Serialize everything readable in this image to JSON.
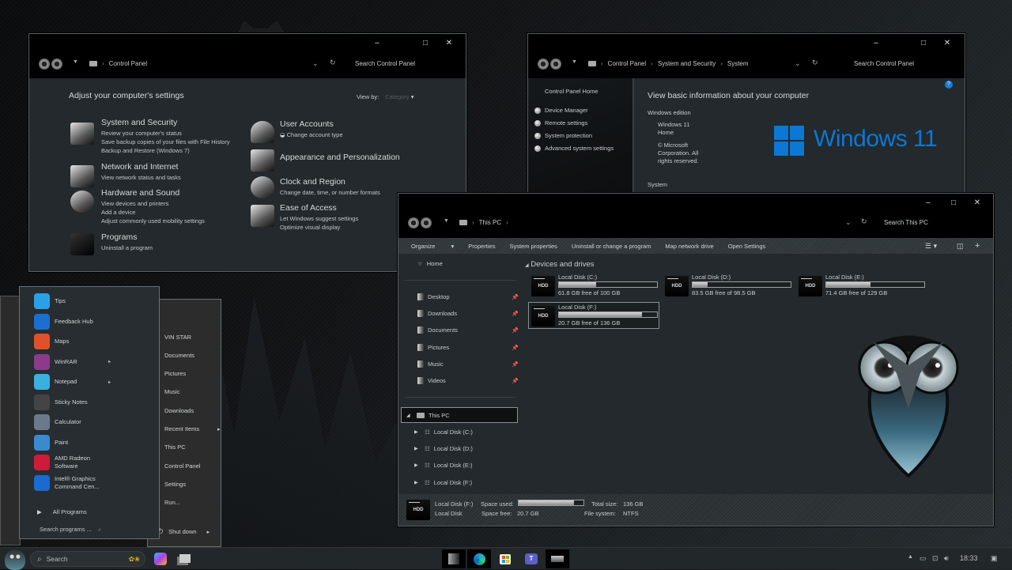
{
  "control_panel": {
    "breadcrumb": [
      "Control Panel"
    ],
    "search_placeholder": "Search Control Panel",
    "heading": "Adjust your computer's settings",
    "view_by_label": "View by:",
    "view_by_value": "Category",
    "categories": [
      {
        "title": "System and Security",
        "links": [
          "Review your computer's status",
          "Save backup copies of your files with File History",
          "Backup and Restore (Windows 7)"
        ]
      },
      {
        "title": "Network and Internet",
        "links": [
          "View network status and tasks"
        ]
      },
      {
        "title": "Hardware and Sound",
        "links": [
          "View devices and printers",
          "Add a device",
          "Adjust commonly used mobility settings"
        ]
      },
      {
        "title": "Programs",
        "links": [
          "Uninstall a program"
        ]
      },
      {
        "title": "User Accounts",
        "links": [
          "Change account type"
        ]
      },
      {
        "title": "Appearance and Personalization",
        "links": []
      },
      {
        "title": "Clock and Region",
        "links": [
          "Change date, time, or number formats"
        ]
      },
      {
        "title": "Ease of Access",
        "links": [
          "Let Windows suggest settings",
          "Optimize visual display"
        ]
      }
    ]
  },
  "system_window": {
    "breadcrumb": [
      "Control Panel",
      "System and Security",
      "System"
    ],
    "search_placeholder": "Search Control Panel",
    "sidebar_home": "Control Panel Home",
    "sidebar_links": [
      "Device Manager",
      "Remote settings",
      "System protection",
      "Advanced system settings"
    ],
    "heading": "View basic information about your computer",
    "edition_label": "Windows edition",
    "edition_name": "Windows 11 Home",
    "copyright": "© Microsoft Corporation. All rights reserved.",
    "logo_text": "Windows 11",
    "system_label": "System",
    "accent": "#0a78d4"
  },
  "explorer": {
    "breadcrumb": [
      "This PC"
    ],
    "search_placeholder": "Search This PC",
    "commands": [
      "Organize",
      "Properties",
      "System properties",
      "Uninstall or change a program",
      "Map network drive",
      "Open Settings"
    ],
    "nav_home": "Home",
    "quick_access": [
      "Desktop",
      "Downloads",
      "Documents",
      "Pictures",
      "Music",
      "Videos"
    ],
    "tree_root": "This PC",
    "tree_children": [
      "Local Disk (C:)",
      "Local Disk (D:)",
      "Local Disk (E:)",
      "Local Disk (F:)"
    ],
    "section_title": "Devices and drives",
    "drives": [
      {
        "name": "Local Disk (C:)",
        "free_text": "61.8 GB free of 100 GB",
        "used_fraction": 0.38
      },
      {
        "name": "Local Disk (D:)",
        "free_text": "83.5 GB free of 98.5 GB",
        "used_fraction": 0.15
      },
      {
        "name": "Local Disk (E:)",
        "free_text": "71.4 GB free of 129 GB",
        "used_fraction": 0.45
      },
      {
        "name": "Local Disk (F:)",
        "free_text": "20.7 GB free of 136 GB",
        "used_fraction": 0.85
      }
    ],
    "status": {
      "name": "Local Disk (F:)",
      "type": "Local Disk",
      "space_used_label": "Space used:",
      "space_used_fraction": 0.85,
      "space_free_label": "Space free:",
      "space_free": "20.7 GB",
      "total_size_label": "Total size:",
      "total_size": "136 GB",
      "file_system_label": "File system:",
      "file_system": "NTFS"
    }
  },
  "start_menu": {
    "apps": [
      {
        "name": "Tips",
        "icon": "lightbulb-icon",
        "color": "#2aa0e8",
        "arrow": false
      },
      {
        "name": "Feedback Hub",
        "icon": "feedback-icon",
        "color": "#1a6fd0",
        "arrow": false
      },
      {
        "name": "Maps",
        "icon": "map-pin-icon",
        "color": "#e0502a",
        "arrow": false
      },
      {
        "name": "WinRAR",
        "icon": "winrar-icon",
        "color": "#8a3c8a",
        "arrow": true
      },
      {
        "name": "Notepad",
        "icon": "notepad-icon",
        "color": "#3ab0e0",
        "arrow": true
      },
      {
        "name": "Sticky Notes",
        "icon": "sticky-notes-icon",
        "color": "#444444",
        "arrow": false
      },
      {
        "name": "Calculator",
        "icon": "calculator-icon",
        "color": "#6a7a8a",
        "arrow": false
      },
      {
        "name": "Paint",
        "icon": "paint-icon",
        "color": "#3a8ad0",
        "arrow": false
      },
      {
        "name": "AMD Radeon Software",
        "icon": "amd-icon",
        "color": "#d01a3a",
        "arrow": false
      },
      {
        "name": "Intel® Graphics Command Cen...",
        "icon": "intel-icon",
        "color": "#1a6ad0",
        "arrow": false
      }
    ],
    "all_programs": "All Programs",
    "search_placeholder": "Search programs ...",
    "right_items": [
      {
        "name": "VIN STAR",
        "icon": "user-folder-icon",
        "arrow": false
      },
      {
        "name": "Documents",
        "icon": "document-icon",
        "arrow": false
      },
      {
        "name": "Pictures",
        "icon": "picture-icon",
        "arrow": false
      },
      {
        "name": "Music",
        "icon": "music-icon",
        "arrow": false
      },
      {
        "name": "Downloads",
        "icon": "download-icon",
        "arrow": false
      },
      {
        "name": "Recent Items",
        "icon": "clock-icon",
        "arrow": true
      },
      {
        "name": "This PC",
        "icon": "computer-icon",
        "arrow": false
      },
      {
        "name": "Control Panel",
        "icon": "control-panel-icon",
        "arrow": false
      },
      {
        "name": "Settings",
        "icon": "gear-icon",
        "arrow": false
      },
      {
        "name": "Run...",
        "icon": "run-icon",
        "arrow": false
      }
    ],
    "shutdown": "Shut down"
  },
  "taskbar": {
    "search_placeholder": "Search",
    "pinned": [
      "File Explorer",
      "Microsoft Edge",
      "Microsoft Store",
      "Microsoft Teams",
      "Drive"
    ],
    "clock": "18:33"
  }
}
